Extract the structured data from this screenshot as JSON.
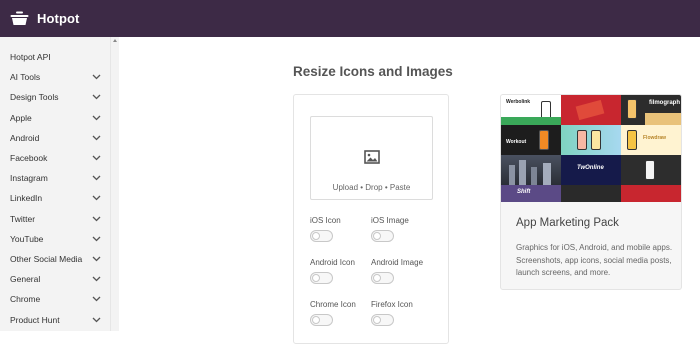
{
  "app": {
    "name": "Hotpot"
  },
  "sidebar": {
    "items": [
      {
        "label": "Hotpot API",
        "has_chevron": false
      },
      {
        "label": "AI Tools",
        "has_chevron": true
      },
      {
        "label": "Design Tools",
        "has_chevron": true
      },
      {
        "label": "Apple",
        "has_chevron": true
      },
      {
        "label": "Android",
        "has_chevron": true
      },
      {
        "label": "Facebook",
        "has_chevron": true
      },
      {
        "label": "Instagram",
        "has_chevron": true
      },
      {
        "label": "LinkedIn",
        "has_chevron": true
      },
      {
        "label": "Twitter",
        "has_chevron": true
      },
      {
        "label": "YouTube",
        "has_chevron": true
      },
      {
        "label": "Other Social Media",
        "has_chevron": true
      },
      {
        "label": "General",
        "has_chevron": true
      },
      {
        "label": "Chrome",
        "has_chevron": true
      },
      {
        "label": "Product Hunt",
        "has_chevron": true
      }
    ]
  },
  "main": {
    "title": "Resize Icons and Images",
    "dropzone": {
      "text": "Upload • Drop • Paste",
      "icon": "image-icon"
    },
    "options": [
      {
        "label": "iOS Icon",
        "checked": false
      },
      {
        "label": "iOS Image",
        "checked": false
      },
      {
        "label": "Android Icon",
        "checked": false
      },
      {
        "label": "Android Image",
        "checked": false
      },
      {
        "label": "Chrome Icon",
        "checked": false
      },
      {
        "label": "Firefox Icon",
        "checked": false
      }
    ]
  },
  "promo": {
    "title": "App Marketing Pack",
    "description": "Graphics for iOS, Android, and mobile apps. Screenshots, app icons, social media posts, launch screens, and more.",
    "tile_labels": [
      "Werbolink",
      "",
      "filmograph",
      "Workout",
      "",
      "Flowdraw",
      "",
      "TwOnline",
      "",
      "Shift",
      "",
      ""
    ]
  },
  "colors": {
    "topbar": "#3d2a46",
    "sidebar_bg": "#f3f3f3"
  }
}
